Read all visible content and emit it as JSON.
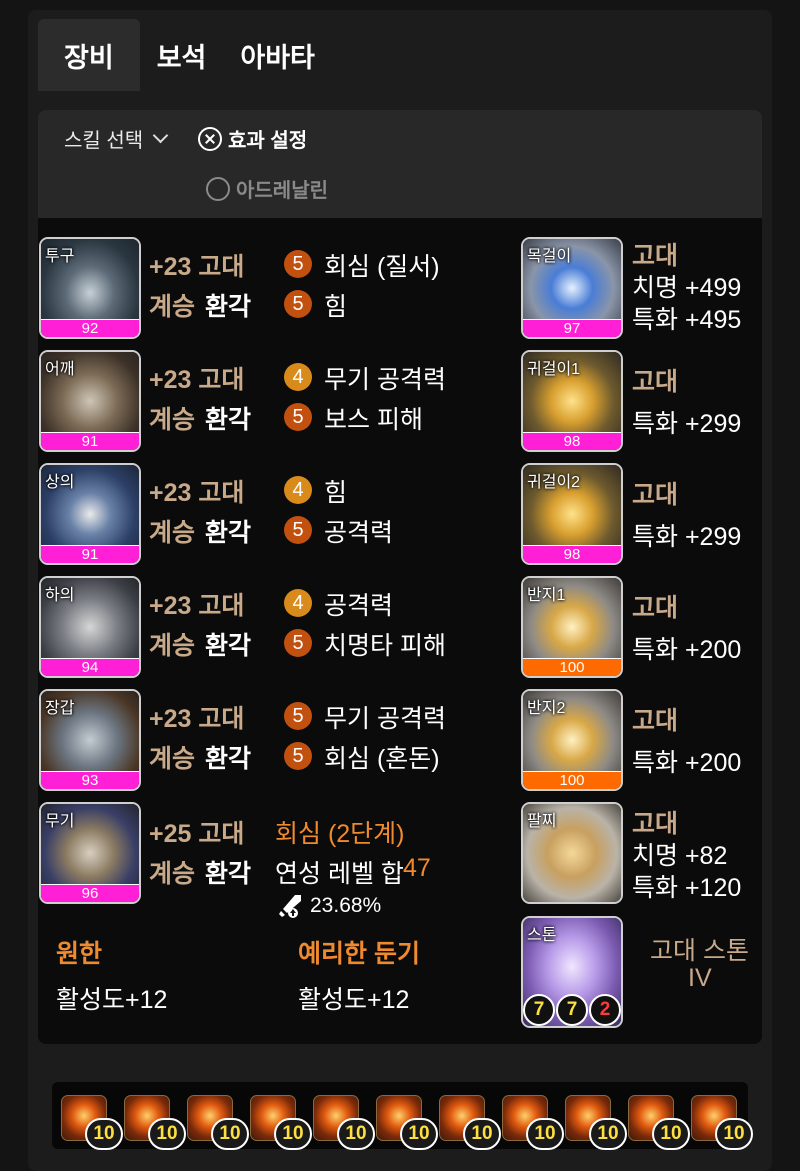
{
  "tabs": [
    {
      "label": "장비",
      "active": true
    },
    {
      "label": "보석",
      "active": false
    },
    {
      "label": "아바타",
      "active": false
    }
  ],
  "options": {
    "skill_select": "스킬 선택",
    "effect_setting": "효과 설정",
    "adrenaline": "아드레날린"
  },
  "armor": [
    {
      "slot": "투구",
      "quality": "92",
      "upgrade": "+23 고대",
      "succession": "계승",
      "tier": "환각",
      "effects": [
        {
          "level": "5",
          "name": "회심 (질서)"
        },
        {
          "level": "5",
          "name": "힘"
        }
      ]
    },
    {
      "slot": "어깨",
      "quality": "91",
      "upgrade": "+23 고대",
      "succession": "계승",
      "tier": "환각",
      "effects": [
        {
          "level": "4",
          "name": "무기 공격력"
        },
        {
          "level": "5",
          "name": "보스 피해"
        }
      ]
    },
    {
      "slot": "상의",
      "quality": "91",
      "upgrade": "+23 고대",
      "succession": "계승",
      "tier": "환각",
      "effects": [
        {
          "level": "4",
          "name": "힘"
        },
        {
          "level": "5",
          "name": "공격력"
        }
      ]
    },
    {
      "slot": "하의",
      "quality": "94",
      "upgrade": "+23 고대",
      "succession": "계승",
      "tier": "환각",
      "effects": [
        {
          "level": "4",
          "name": "공격력"
        },
        {
          "level": "5",
          "name": "치명타 피해"
        }
      ]
    },
    {
      "slot": "장갑",
      "quality": "93",
      "upgrade": "+23 고대",
      "succession": "계승",
      "tier": "환각",
      "effects": [
        {
          "level": "5",
          "name": "무기 공격력"
        },
        {
          "level": "5",
          "name": "회심 (혼돈)"
        }
      ]
    }
  ],
  "weapon": {
    "slot": "무기",
    "quality": "96",
    "upgrade": "+25 고대",
    "succession": "계승",
    "tier": "환각",
    "effect": "회심 (2단계)",
    "refine_label": "연성 레벨 합",
    "refine_value": "47",
    "bonus": "23.68%"
  },
  "engravings": [
    {
      "name": "원한",
      "value": "활성도+12"
    },
    {
      "name": "예리한 둔기",
      "value": "활성도+12"
    }
  ],
  "accessories": [
    {
      "slot": "목걸이",
      "quality": "97",
      "grade": "고대",
      "stats": [
        "치명 +499",
        "특화 +495"
      ],
      "bar": "pink"
    },
    {
      "slot": "귀걸이1",
      "quality": "98",
      "grade": "고대",
      "stats": [
        "특화 +299"
      ],
      "bar": "pink"
    },
    {
      "slot": "귀걸이2",
      "quality": "98",
      "grade": "고대",
      "stats": [
        "특화 +299"
      ],
      "bar": "pink"
    },
    {
      "slot": "반지1",
      "quality": "100",
      "grade": "고대",
      "stats": [
        "특화 +200"
      ],
      "bar": "orange"
    },
    {
      "slot": "반지2",
      "quality": "100",
      "grade": "고대",
      "stats": [
        "특화 +200"
      ],
      "bar": "orange"
    }
  ],
  "bracelet": {
    "slot": "팔찌",
    "grade": "고대",
    "stats": [
      "치명 +82",
      "특화 +120"
    ]
  },
  "stone": {
    "slot": "스톤",
    "name_line1": "고대 스톤",
    "name_line2": "IV",
    "levels": [
      "7",
      "7",
      "2"
    ]
  },
  "gems": [
    "10",
    "10",
    "10",
    "10",
    "10",
    "10",
    "10",
    "10",
    "10",
    "10",
    "10"
  ],
  "colors": {
    "quality_pink": "#ff1fd6",
    "quality_orange": "#ff6a00",
    "accent_orange": "#f08a2e",
    "tan": "#c8a98a"
  }
}
